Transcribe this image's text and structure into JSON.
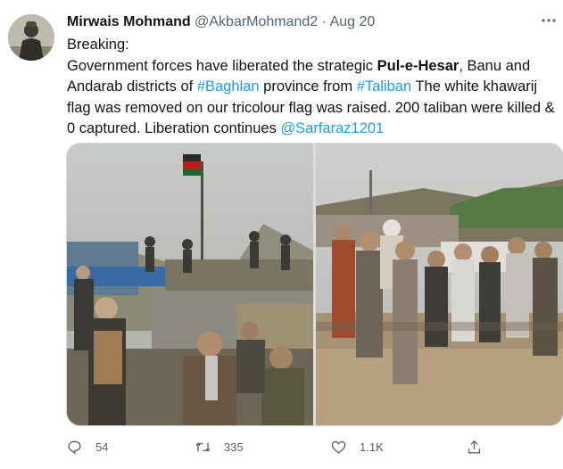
{
  "author": {
    "name": "Mirwais Mohmand",
    "handle": "@AkbarMohmand2",
    "separator": "·",
    "date": "Aug 20"
  },
  "tweet": {
    "line1": "Breaking:",
    "line2_a": "Government forces have liberated the strategic ",
    "line2_bold": "Pul-e-Hesar",
    "line2_b": ", Banu and",
    "line3_a": "Andarab districts of ",
    "line3_tag1": "#Baghlan",
    "line3_b": " province from ",
    "line3_tag2": "#Taliban",
    "line3_c": " The white khawarij",
    "line4": "flag was removed on our tricolour flag was raised. 200 taliban were killed &",
    "line5_a": "0 captured. Liberation continues ",
    "line5_mention": "@Sarfaraz1201"
  },
  "actions": {
    "reply_count": "54",
    "retweet_count": "335",
    "like_count": "1.1K"
  },
  "colors": {
    "link": "#1d9bf0",
    "muted": "#536471",
    "text": "#0f1419",
    "border": "#cfd9de"
  },
  "icons": {
    "reply": "reply-icon",
    "retweet": "retweet-icon",
    "like": "heart-icon",
    "share": "share-icon",
    "more": "more-icon"
  }
}
